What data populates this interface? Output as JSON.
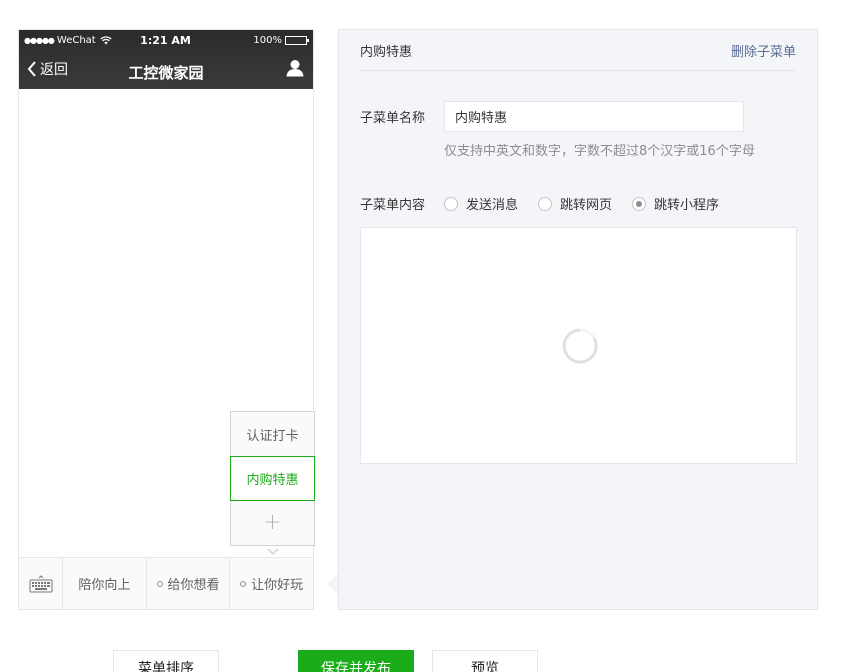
{
  "phone": {
    "status": {
      "signal": "●●●●●",
      "carrier": "WeChat",
      "time": "1:21 AM",
      "battery": "100%",
      "battery_level": 1.0
    },
    "nav": {
      "back_label": "返回",
      "title": "工控微家园"
    },
    "submenu": {
      "items": [
        "认证打卡",
        "内购特惠"
      ],
      "add_symbol": "+"
    },
    "menu": {
      "items": [
        "陪你向上",
        "给你想看",
        "让你好玩"
      ]
    }
  },
  "panel": {
    "title": "内购特惠",
    "delete_label": "删除子菜单",
    "name_label": "子菜单名称",
    "name_value": "内购特惠",
    "hint": "仅支持中英文和数字，字数不超过8个汉字或16个字母",
    "content_label": "子菜单内容",
    "options": [
      "发送消息",
      "跳转网页",
      "跳转小程序"
    ],
    "selected_option": "跳转小程序"
  },
  "buttons": {
    "sort": "菜单排序",
    "save": "保存并发布",
    "preview": "预览"
  },
  "colors": {
    "accent": "#1aad19",
    "link": "#576b95",
    "header_bg": "#333335",
    "panel_bg": "#f4f5f9"
  }
}
